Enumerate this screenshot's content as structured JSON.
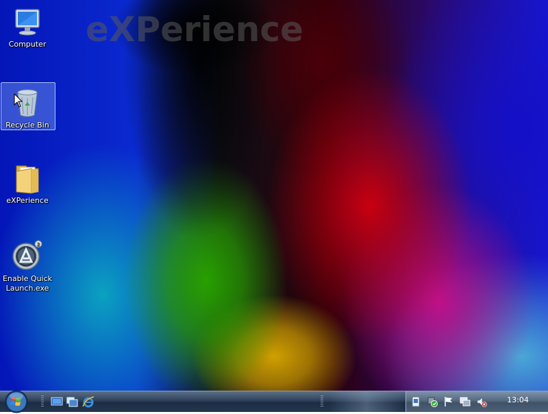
{
  "desktop": {
    "brand": "eXPerience",
    "icons": [
      {
        "label": "Computer",
        "icon": "computer-icon"
      },
      {
        "label": "Recycle Bin",
        "icon": "recycle-bin-icon",
        "selected": true
      },
      {
        "label": "eXPerience",
        "icon": "folder-icon"
      },
      {
        "label": "Enable Quick Launch.exe",
        "icon": "application-icon"
      }
    ]
  },
  "taskbar": {
    "start": "start-orb-icon",
    "quick_launch": [
      "show-desktop-icon",
      "switch-windows-icon",
      "internet-explorer-icon"
    ],
    "tray_icons": [
      "document-icon",
      "security-shield-icon",
      "action-center-flag-icon",
      "network-icon",
      "volume-muted-icon"
    ],
    "clock": "13:04"
  }
}
